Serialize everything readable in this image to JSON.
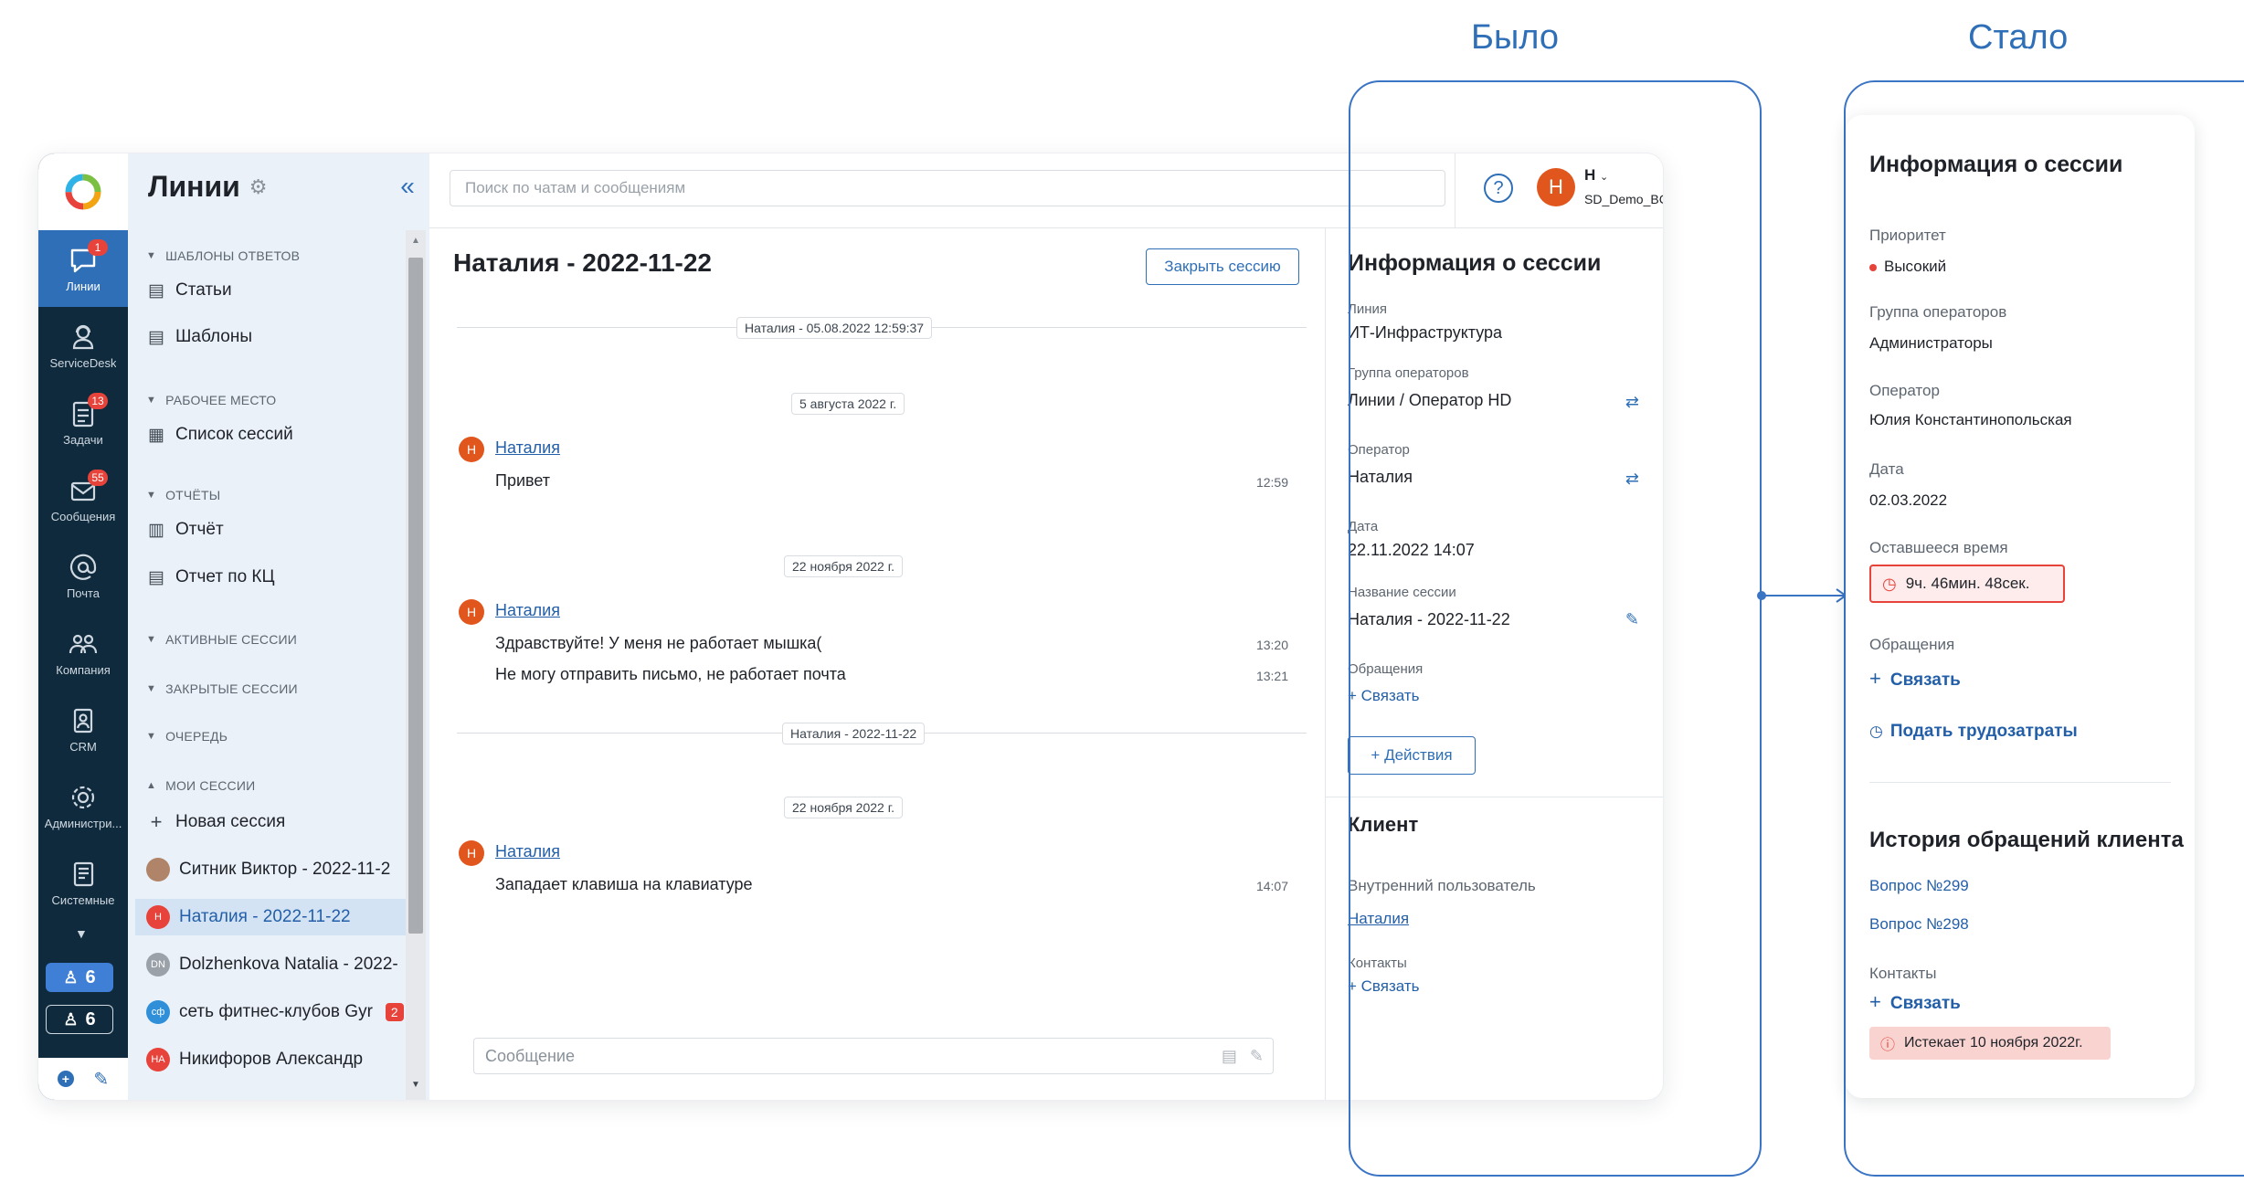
{
  "labels": {
    "before": "Было",
    "after": "Стало"
  },
  "rail": {
    "items": [
      {
        "label": "Линии",
        "badge": "1",
        "icon": "chat-icon"
      },
      {
        "label": "ServiceDesk",
        "badge": "",
        "icon": "agent-icon"
      },
      {
        "label": "Задачи",
        "badge": "13",
        "icon": "tasks-icon"
      },
      {
        "label": "Сообщения",
        "badge": "55",
        "icon": "mail-icon"
      },
      {
        "label": "Почта",
        "badge": "",
        "icon": "at-icon"
      },
      {
        "label": "Компания",
        "badge": "",
        "icon": "people-icon"
      },
      {
        "label": "CRM",
        "badge": "",
        "icon": "crm-icon"
      },
      {
        "label": "Администри...",
        "badge": "",
        "icon": "gear-icon"
      },
      {
        "label": "Системные",
        "badge": "",
        "icon": "book-icon"
      }
    ],
    "counter1": "6",
    "counter2": "6"
  },
  "sidebar": {
    "title": "Линии",
    "sections": {
      "templates": "ШАБЛОНЫ ОТВЕТОВ",
      "workplace": "РАБОЧЕЕ МЕСТО",
      "reports": "ОТЧЁТЫ",
      "active": "АКТИВНЫЕ СЕССИИ",
      "closed": "ЗАКРЫТЫЕ СЕССИИ",
      "queue": "ОЧЕРЕДЬ",
      "mine": "МОИ СЕССИИ"
    },
    "items": {
      "articles": "Статьи",
      "templates": "Шаблоны",
      "sessions": "Список сессий",
      "report": "Отчёт",
      "report_kc": "Отчет по КЦ",
      "new_session": "Новая сессия"
    },
    "my_sessions": [
      {
        "name": "Ситник Виктор - 2022-11-2",
        "initials": "",
        "color": "#b08468",
        "badge": ""
      },
      {
        "name": "Наталия - 2022-11-22",
        "initials": "Н",
        "color": "#e8433a",
        "badge": ""
      },
      {
        "name": "Dolzhenkova Natalia - 2022-",
        "initials": "DN",
        "color": "#9aa1a9",
        "badge": ""
      },
      {
        "name": "сеть фитнес-клубов Gyr",
        "initials": "сф",
        "color": "#2f8fd8",
        "badge": "2"
      },
      {
        "name": "Никифоров Александр",
        "initials": "НА",
        "color": "#e8433a",
        "badge": ""
      }
    ]
  },
  "topbar": {
    "search_placeholder": "Поиск по чатам и сообщениям",
    "user_initial": "Н",
    "user_name": "Н",
    "user_sub": "SD_Demo_BC"
  },
  "chat": {
    "title": "Наталия - 2022-11-22",
    "close_label": "Закрыть сессию",
    "session1_chip": "Наталия - 05.08.2022 12:59:37",
    "date1": "5 августа 2022 г.",
    "msg1_author": "Наталия",
    "msg1_text": "Привет",
    "msg1_time": "12:59",
    "date2": "22 ноября 2022 г.",
    "msg2_author": "Наталия",
    "msg2_text": "Здравствуйте! У меня не работает мышка(",
    "msg2_time": "13:20",
    "msg3_text": "Не могу отправить письмо, не работает почта",
    "msg3_time": "13:21",
    "session2_chip": "Наталия - 2022-11-22",
    "date3": "22 ноября 2022 г.",
    "msg4_author": "Наталия",
    "msg4_text": "Западает клавиша на клавиатуре",
    "msg4_time": "14:07",
    "avatar_initial": "Н",
    "composer_placeholder": "Сообщение"
  },
  "info_old": {
    "title": "Информация о сессии",
    "line_label": "Линия",
    "line_value": "ИТ-Инфраструктура",
    "group_label": "Группа операторов",
    "group_value": "Линии / Оператор HD",
    "operator_label": "Оператор",
    "operator_value": "Наталия",
    "date_label": "Дата",
    "date_value": "22.11.2022 14:07",
    "name_label": "Название сессии",
    "name_value": "Наталия - 2022-11-22",
    "requests_label": "Обращения",
    "link_label": "+ Связать",
    "actions_label": "+ Действия",
    "client_title": "Клиент",
    "internal_label": "Внутренний пользователь",
    "internal_value": "Наталия",
    "contacts_label": "Контакты",
    "contacts_link": "+ Связать"
  },
  "info_new": {
    "title": "Информация о сессии",
    "priority_label": "Приоритет",
    "priority_value": "Высокий",
    "group_label": "Группа операторов",
    "group_value": "Администраторы",
    "operator_label": "Оператор",
    "operator_value": "Юлия Константинопольская",
    "date_label": "Дата",
    "date_value": "02.03.2022",
    "remaining_label": "Оставшееся время",
    "remaining_value": "9ч. 46мин. 48сек.",
    "requests_label": "Обращения",
    "link_label": "Связать",
    "worklog_label": "Подать трудозатраты",
    "history_title": "История обращений клиента",
    "q1": "Вопрос №299",
    "q2": "Вопрос №298",
    "contacts_label": "Контакты",
    "contacts_link": "Связать",
    "expire_label": "Истекает 10 ноября 2022г."
  },
  "colors": {
    "accent": "#2f6fb7",
    "rail": "#0f2a3d",
    "danger": "#e8433a",
    "sidebar": "#eaf1f8"
  }
}
